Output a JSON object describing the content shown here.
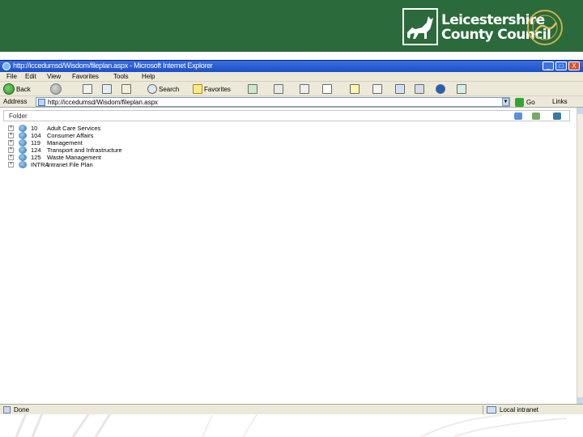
{
  "slide": {
    "logo": {
      "line1": "Leicestershire",
      "line2": "County Council",
      "seal_text": "RATED AS Excellent BY THE AUDIT COMMISSION"
    },
    "colors": {
      "banner": "#2b6a3b",
      "titlebar": "#1b4fc7",
      "chrome": "#ece9d8"
    }
  },
  "browser": {
    "title": "http://iccedumsd/Wisdom/fileplan.aspx - Microsoft Internet Explorer",
    "window_buttons": [
      "_",
      "□",
      "X"
    ],
    "menu": [
      "File",
      "Edit",
      "View",
      "Favorites",
      "Tools",
      "Help"
    ],
    "toolbar": {
      "back": "Back",
      "search": "Search",
      "favorites": "Favorites"
    },
    "address": {
      "label": "Address",
      "url": "http://iccedumsd/Wisdom/fileplan.aspx",
      "go": "Go",
      "links": "Links"
    },
    "status": {
      "text": "Done",
      "zone": "Local intranet"
    }
  },
  "content": {
    "folder_label": "Folder",
    "tree": [
      {
        "code": "10",
        "name": "Adult Care Services"
      },
      {
        "code": "104",
        "name": "Consumer Affairs"
      },
      {
        "code": "119",
        "name": "Management"
      },
      {
        "code": "124",
        "name": "Transport and Infrastructure"
      },
      {
        "code": "125",
        "name": "Waste Management"
      },
      {
        "code": "INTRA",
        "name": "Intranet File Plan"
      }
    ]
  }
}
